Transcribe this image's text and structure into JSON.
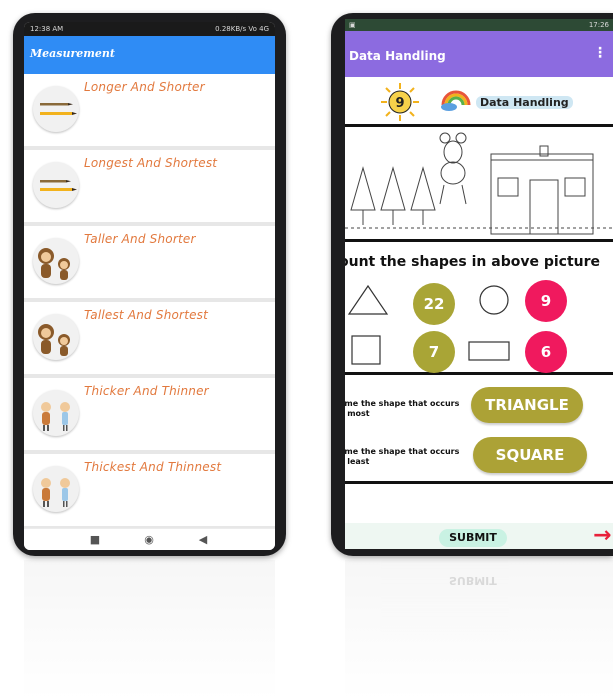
{
  "left_app": {
    "status_time": "12:38 AM",
    "status_right": "0.28KB/s  Vo  4G",
    "title": "Measurement",
    "items": [
      {
        "label": "Longer And Shorter",
        "icon": "pencils-icon"
      },
      {
        "label": "Longest And Shortest",
        "icon": "pencils-icon"
      },
      {
        "label": "Taller And Shorter",
        "icon": "monkeys-icon"
      },
      {
        "label": "Tallest And Shortest",
        "icon": "monkeys-icon"
      },
      {
        "label": "Thicker And Thinner",
        "icon": "kids-icon"
      },
      {
        "label": "Thickest And Thinnest",
        "icon": "kids-icon"
      }
    ],
    "nav": [
      "square-nav-icon",
      "circle-nav-icon",
      "back-triangle-icon"
    ]
  },
  "right_app": {
    "status_right": "17:26",
    "title": "Data Handling",
    "banner": {
      "number": "9",
      "title": "Data Handling"
    },
    "count_heading": "ount the shapes in above picture",
    "counts": [
      {
        "shape": "triangle",
        "value": "22",
        "color": "#a9a536"
      },
      {
        "shape": "circle",
        "value": "9",
        "color": "#f0195e"
      },
      {
        "shape": "square",
        "value": "7",
        "color": "#a9a536"
      },
      {
        "shape": "rectangle",
        "value": "6",
        "color": "#f0195e"
      }
    ],
    "questions": [
      {
        "line1": "ame the shape that occurs",
        "line2": "e most",
        "answer": "TRIANGLE"
      },
      {
        "line1": "ame the shape that occurs",
        "line2": "e least",
        "answer": "SQUARE"
      }
    ],
    "submit_label": "SUBMIT"
  },
  "colors": {
    "left_appbar": "#2f8cf5",
    "right_appbar": "#8c6be0",
    "list_label": "#e2793e",
    "olive": "#a9a536",
    "pink": "#f0195e",
    "arrow": "#e8203a"
  }
}
